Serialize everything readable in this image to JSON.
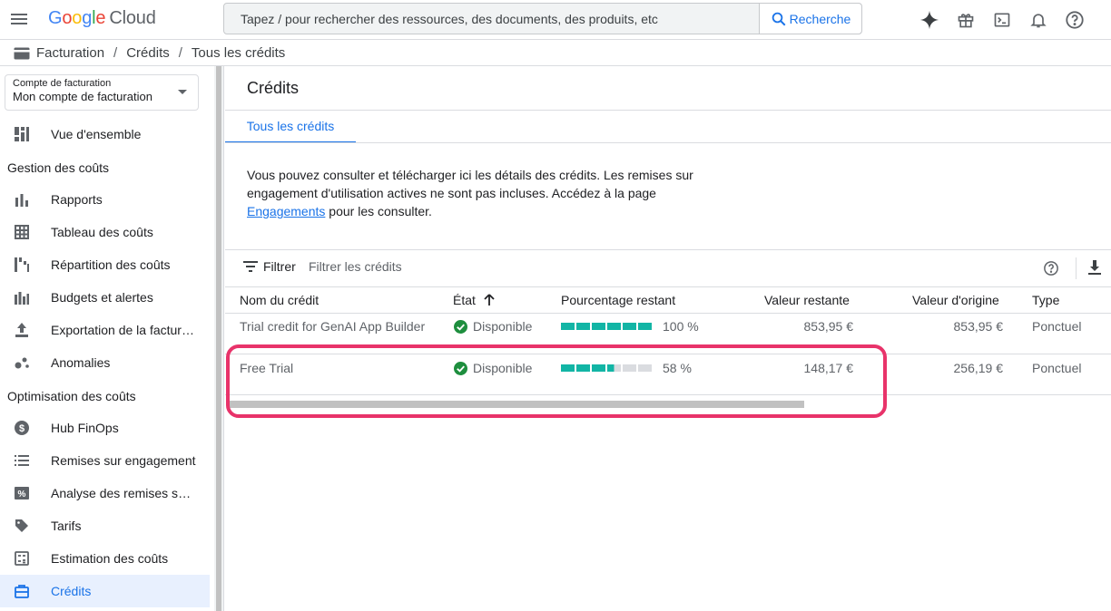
{
  "header": {
    "logo_google": [
      "G",
      "o",
      "o",
      "g",
      "l",
      "e"
    ],
    "logo_cloud": "Cloud",
    "search_placeholder": "Tapez / pour rechercher des ressources, des documents, des produits, etc",
    "search_button": "Recherche"
  },
  "breadcrumb": [
    "Facturation",
    "Crédits",
    "Tous les crédits"
  ],
  "sidebar": {
    "account_label": "Compte de facturation",
    "account_value": "Mon compte de facturation",
    "overview": "Vue d'ensemble",
    "section_costs": "Gestion des coûts",
    "costs_items": [
      "Rapports",
      "Tableau des coûts",
      "Répartition des coûts",
      "Budgets et alertes",
      "Exportation de la facturation",
      "Anomalies"
    ],
    "section_optim": "Optimisation des coûts",
    "optim_items": [
      "Hub FinOps",
      "Remises sur engagement",
      "Analyse des remises sur engagement",
      "Tarifs",
      "Estimation des coûts",
      "Crédits"
    ]
  },
  "main": {
    "title": "Crédits",
    "tab": "Tous les crédits",
    "desc_before": "Vous pouvez consulter et télécharger ici les détails des crédits. Les remises sur engagement d'utilisation actives ne sont pas incluses. Accédez à la page ",
    "desc_link": "Engagements",
    "desc_after": " pour les consulter.",
    "filter_label": "Filtrer",
    "filter_placeholder": "Filtrer les crédits"
  },
  "table": {
    "columns": [
      "Nom du crédit",
      "État",
      "Pourcentage restant",
      "Valeur restante",
      "Valeur d'origine",
      "Type"
    ],
    "rows": [
      {
        "name": "Trial credit for GenAI App Builder",
        "status": "Disponible",
        "percent_label": "100 %",
        "percent": 100,
        "remaining": "853,95 €",
        "original": "853,95 €",
        "type": "Ponctuel"
      },
      {
        "name": "Free Trial",
        "status": "Disponible",
        "percent_label": "58 %",
        "percent": 58,
        "remaining": "148,17 €",
        "original": "256,19 €",
        "type": "Ponctuel"
      }
    ]
  },
  "colors": {
    "accent": "#1a73e8",
    "progress": "#12b5a5",
    "highlight": "#e8336a",
    "success": "#1e8e3e"
  }
}
